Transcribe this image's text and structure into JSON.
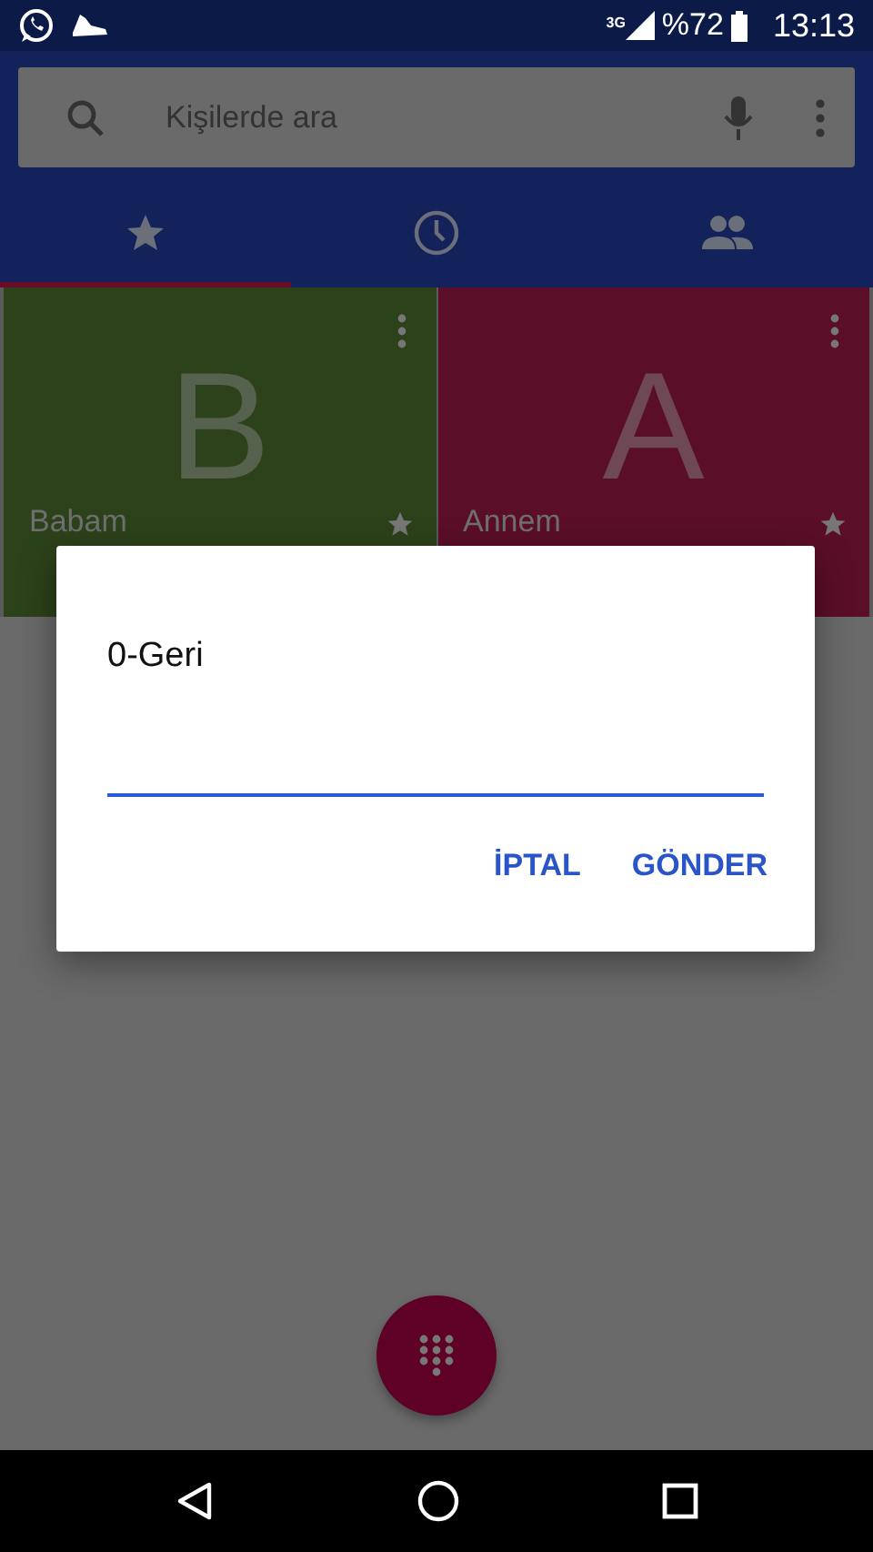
{
  "status_bar": {
    "network": "3G",
    "battery": "%72",
    "time": "13:13"
  },
  "search": {
    "placeholder": "Kişilerde ara"
  },
  "tabs": [
    {
      "kind": "star",
      "selected": true
    },
    {
      "kind": "clock",
      "selected": false
    },
    {
      "kind": "people",
      "selected": false
    }
  ],
  "favorites": [
    {
      "initial": "B",
      "name": "Babam",
      "color": "#2c421a"
    },
    {
      "initial": "A",
      "name": "Annem",
      "color": "#5b0e28"
    }
  ],
  "dialog": {
    "title": "0-Geri",
    "buttons": [
      "İPTAL",
      "GÖNDER"
    ]
  }
}
